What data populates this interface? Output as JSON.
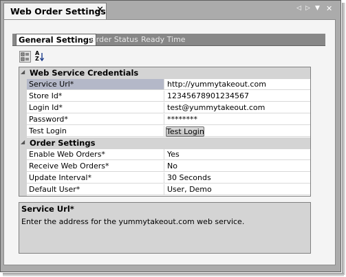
{
  "window": {
    "title": "Web Order Settings",
    "close_glyph": "✕",
    "controls": [
      {
        "name": "scroll-left-icon",
        "glyph": "◁"
      },
      {
        "name": "scroll-right-icon",
        "glyph": "▷"
      },
      {
        "name": "dropdown-icon",
        "glyph": "▼"
      },
      {
        "name": "close-icon",
        "glyph": "✕"
      }
    ]
  },
  "tabs": [
    {
      "label": "General Settings",
      "active": true
    },
    {
      "label": "Order Status",
      "active": false
    },
    {
      "label": "Ready Time",
      "active": false
    }
  ],
  "toolbar": [
    {
      "name": "categorized-view-icon",
      "pressed": true
    },
    {
      "name": "alphabetical-sort-icon",
      "pressed": false,
      "label_a": "A",
      "label_z": "Z"
    }
  ],
  "property_grid": {
    "categories": [
      {
        "title": "Web Service Credentials",
        "expanded": true,
        "properties": [
          {
            "name": "Service Url*",
            "value": "http://yummytakeout.com",
            "selected": true
          },
          {
            "name": "Store Id*",
            "value": "12345678901234567"
          },
          {
            "name": "Login Id*",
            "value": "test@yummytakeout.com"
          },
          {
            "name": "Password*",
            "value": "********"
          },
          {
            "name": "Test Login",
            "button_label": "Test Login"
          }
        ]
      },
      {
        "title": "Order Settings",
        "expanded": true,
        "properties": [
          {
            "name": "Enable Web Orders*",
            "value": "Yes"
          },
          {
            "name": "Receive Web Orders*",
            "value": "No"
          },
          {
            "name": "Update Interval*",
            "value": "30 Seconds"
          },
          {
            "name": "Default User*",
            "value": "User, Demo"
          }
        ]
      }
    ]
  },
  "help": {
    "title": "Service Url*",
    "description": "Enter the address for the yummytakeout.com web service."
  },
  "colors": {
    "frame": "#ababab",
    "tab_strip": "#878787",
    "category_background": "#d4d4d4",
    "selection": "#b4b8c8"
  }
}
